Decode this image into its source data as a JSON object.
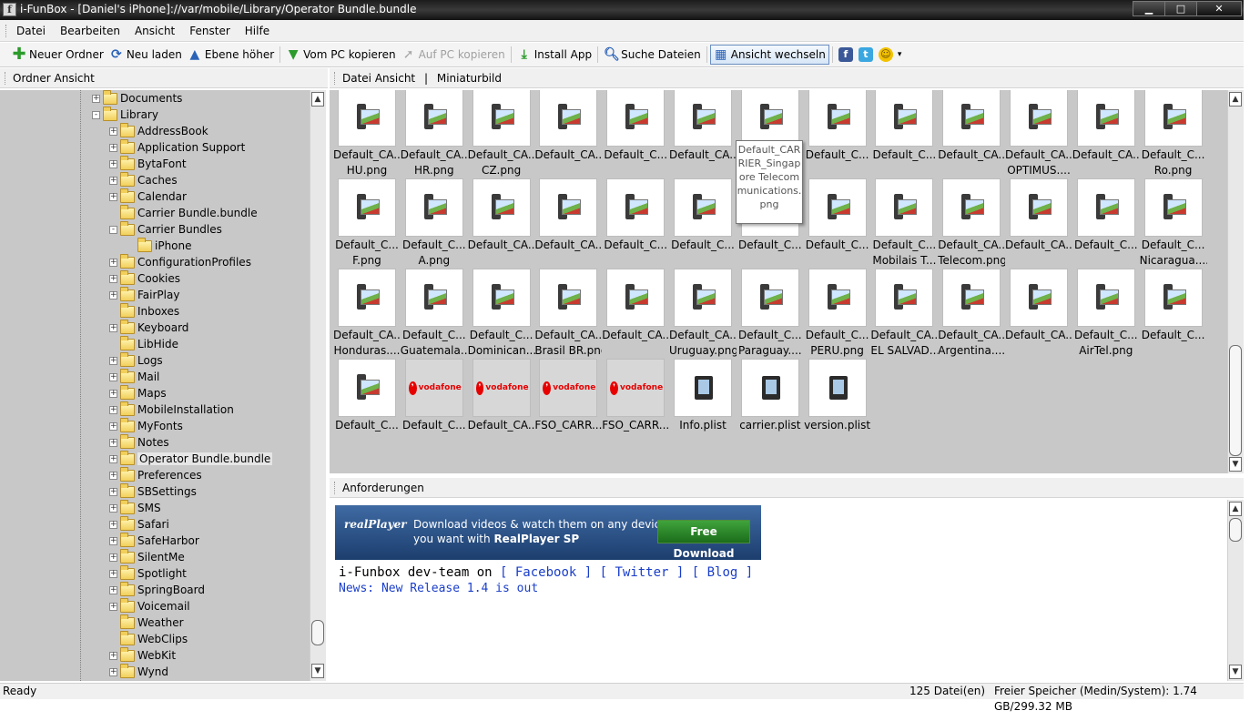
{
  "window": {
    "title": "i-FunBox - [Daniel's iPhone]://var/mobile/Library/Operator Bundle.bundle",
    "app_icon": "f"
  },
  "menu": [
    "Datei",
    "Bearbeiten",
    "Ansicht",
    "Fenster",
    "Hilfe"
  ],
  "toolbar": {
    "new_folder": "Neuer Ordner",
    "reload": "Neu laden",
    "up_level": "Ebene höher",
    "copy_from_pc": "Vom PC kopieren",
    "copy_to_pc": "Auf PC kopieren",
    "install_app": "Install App",
    "search_files": "Suche Dateien",
    "switch_view": "Ansicht wechseln",
    "facebook_glyph": "f",
    "twitter_glyph": "t"
  },
  "left_pane": {
    "header": "Ordner Ansicht",
    "tree": [
      {
        "label": "Documents",
        "level": 0,
        "expander": "+"
      },
      {
        "label": "Library",
        "level": 0,
        "expander": "-"
      },
      {
        "label": "AddressBook",
        "level": 1,
        "expander": "+"
      },
      {
        "label": "Application Support",
        "level": 1,
        "expander": "+"
      },
      {
        "label": "BytaFont",
        "level": 1,
        "expander": "+"
      },
      {
        "label": "Caches",
        "level": 1,
        "expander": "+"
      },
      {
        "label": "Calendar",
        "level": 1,
        "expander": "+"
      },
      {
        "label": "Carrier Bundle.bundle",
        "level": 1,
        "expander": ""
      },
      {
        "label": "Carrier Bundles",
        "level": 1,
        "expander": "-"
      },
      {
        "label": "iPhone",
        "level": 2,
        "expander": ""
      },
      {
        "label": "ConfigurationProfiles",
        "level": 1,
        "expander": "+"
      },
      {
        "label": "Cookies",
        "level": 1,
        "expander": "+"
      },
      {
        "label": "FairPlay",
        "level": 1,
        "expander": "+"
      },
      {
        "label": "Inboxes",
        "level": 1,
        "expander": ""
      },
      {
        "label": "Keyboard",
        "level": 1,
        "expander": "+"
      },
      {
        "label": "LibHide",
        "level": 1,
        "expander": ""
      },
      {
        "label": "Logs",
        "level": 1,
        "expander": "+"
      },
      {
        "label": "Mail",
        "level": 1,
        "expander": "+"
      },
      {
        "label": "Maps",
        "level": 1,
        "expander": "+"
      },
      {
        "label": "MobileInstallation",
        "level": 1,
        "expander": "+"
      },
      {
        "label": "MyFonts",
        "level": 1,
        "expander": "+"
      },
      {
        "label": "Notes",
        "level": 1,
        "expander": "+"
      },
      {
        "label": "Operator Bundle.bundle",
        "level": 1,
        "expander": "+",
        "selected": true
      },
      {
        "label": "Preferences",
        "level": 1,
        "expander": "+"
      },
      {
        "label": "SBSettings",
        "level": 1,
        "expander": "+"
      },
      {
        "label": "SMS",
        "level": 1,
        "expander": "+"
      },
      {
        "label": "Safari",
        "level": 1,
        "expander": "+"
      },
      {
        "label": "SafeHarbor",
        "level": 1,
        "expander": "+"
      },
      {
        "label": "SilentMe",
        "level": 1,
        "expander": "+"
      },
      {
        "label": "Spotlight",
        "level": 1,
        "expander": "+"
      },
      {
        "label": "SpringBoard",
        "level": 1,
        "expander": "+"
      },
      {
        "label": "Voicemail",
        "level": 1,
        "expander": "+"
      },
      {
        "label": "Weather",
        "level": 1,
        "expander": ""
      },
      {
        "label": "WebClips",
        "level": 1,
        "expander": ""
      },
      {
        "label": "WebKit",
        "level": 1,
        "expander": "+"
      },
      {
        "label": "Wynd",
        "level": 1,
        "expander": "+"
      }
    ]
  },
  "right_pane": {
    "header_view": "Datei Ansicht",
    "header_sep": "|",
    "header_mode": "Miniaturbild",
    "files": [
      [
        "Default_CA...",
        "HU.png",
        "image"
      ],
      [
        "Default_CA...",
        "HR.png",
        "image"
      ],
      [
        "Default_CA...",
        "CZ.png",
        "image"
      ],
      [
        "Default_CA...",
        "",
        "image"
      ],
      [
        "Default_C...",
        "",
        "image"
      ],
      [
        "Default_CA...",
        "",
        "image"
      ],
      [
        "",
        "",
        "image"
      ],
      [
        "Default_C...",
        "",
        "image"
      ],
      [
        "Default_C...",
        "",
        "image"
      ],
      [
        "Default_CA...",
        "",
        "image"
      ],
      [
        "Default_CA...",
        "OPTIMUS....",
        "image"
      ],
      [
        "Default_CA...",
        "",
        "image"
      ],
      [
        "Default_C...",
        "Ro.png",
        "image"
      ],
      [
        "Default_C...",
        "F.png",
        "image"
      ],
      [
        "Default_C...",
        "A.png",
        "image"
      ],
      [
        "Default_CA...",
        "",
        "image"
      ],
      [
        "Default_CA...",
        "",
        "image"
      ],
      [
        "Default_C...",
        "",
        "image"
      ],
      [
        "Default_C...",
        "",
        "image"
      ],
      [
        "Default_C...",
        "",
        "image"
      ],
      [
        "Default_C...",
        "",
        "image"
      ],
      [
        "Default_C...",
        "Mobilais T...",
        "image"
      ],
      [
        "Default_CA...",
        "Telecom.png",
        "image"
      ],
      [
        "Default_CA...",
        "",
        "image"
      ],
      [
        "Default_C...",
        "",
        "image"
      ],
      [
        "Default_C...",
        "Nicaragua....",
        "image"
      ],
      [
        "Default_CA...",
        "Honduras....",
        "image"
      ],
      [
        "Default_C...",
        "Guatemala...",
        "image"
      ],
      [
        "Default_C...",
        "Dominican...",
        "image"
      ],
      [
        "Default_CA...",
        "Brasil BR.png",
        "image"
      ],
      [
        "Default_CA...",
        "",
        "image"
      ],
      [
        "Default_CA...",
        "Uruguay.png",
        "image"
      ],
      [
        "Default_C...",
        "Paraguay....",
        "image"
      ],
      [
        "Default_C...",
        "PERU.png",
        "image"
      ],
      [
        "Default_CA...",
        "EL SALVAD...",
        "image"
      ],
      [
        "Default_CA...",
        "Argentina....",
        "image"
      ],
      [
        "Default_CA...",
        "",
        "image"
      ],
      [
        "Default_C...",
        "AirTel.png",
        "image"
      ],
      [
        "Default_C...",
        "",
        "image"
      ],
      [
        "Default_C...",
        "",
        "image"
      ],
      [
        "Default_C...",
        "",
        "vodafone"
      ],
      [
        "Default_CA...",
        "",
        "vodafone"
      ],
      [
        "FSO_CARR...",
        "",
        "vodafone"
      ],
      [
        "FSO_CARR...",
        "",
        "vodafone"
      ],
      [
        "Info.plist",
        "",
        "plist"
      ],
      [
        "carrier.plist",
        "",
        "plist"
      ],
      [
        "version.plist",
        "",
        "plist"
      ]
    ],
    "vodafone_logo_text": "vodafone",
    "tooltip": "Default_CARRIER_Singapore Telecommunications.png"
  },
  "requests_pane": {
    "header": "Anforderungen",
    "banner": {
      "brand": "realPlayer",
      "line1": "Download videos & watch them on any device",
      "line2_prefix": "you want with ",
      "line2_bold": "RealPlayer SP",
      "button": "Free Download"
    },
    "dev_prefix": "i-Funbox dev-team on ",
    "links": [
      "[ Facebook ]",
      "[ Twitter ]",
      "[ Blog ]"
    ],
    "news": "News: New Release 1.4 is out"
  },
  "status": {
    "left": "Ready",
    "count": "125 Datei(en)",
    "free": "Freier Speicher (Medin/System): 1.74 GB/299.32 MB"
  },
  "colors": {
    "pane_bg": "#c8c8c8",
    "link": "#1a3ec9",
    "vodafone": "#e60000"
  }
}
